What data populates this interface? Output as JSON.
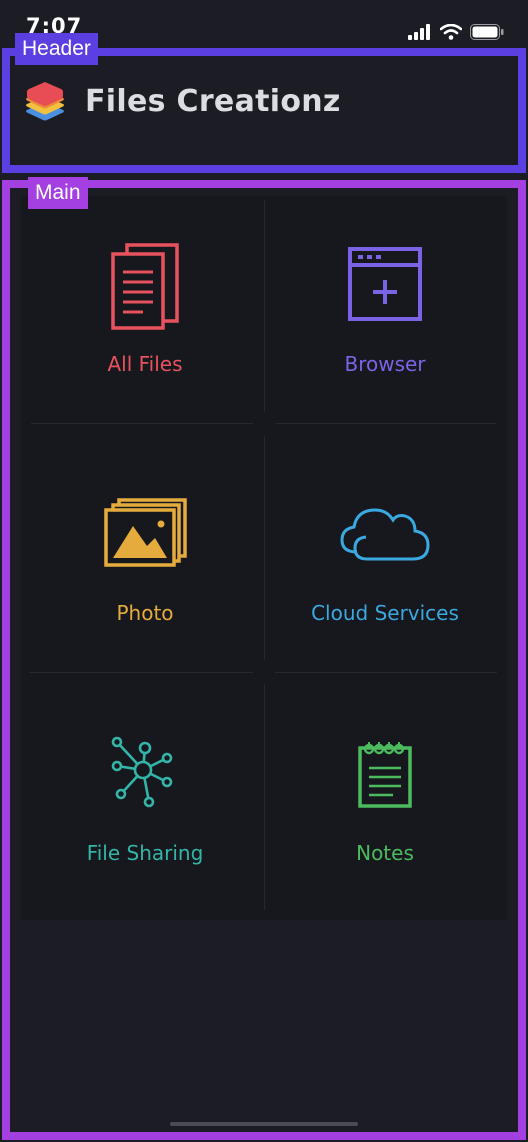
{
  "status_bar": {
    "time": "7:07",
    "icons": [
      "signal-icon",
      "wifi-icon",
      "battery-icon"
    ]
  },
  "regions": {
    "header_label": "Header",
    "main_label": "Main",
    "header_color": "#5b3fe0",
    "main_color": "#a43fe2"
  },
  "header": {
    "app_title": "Files Creationz",
    "logo_icon": "stacked-layers-logo-icon"
  },
  "tiles": [
    {
      "label": "All Files",
      "icon": "documents-icon",
      "color": "#e8525e"
    },
    {
      "label": "Browser",
      "icon": "browser-window-icon",
      "color": "#7b63e6"
    },
    {
      "label": "Photo",
      "icon": "photo-gallery-icon",
      "color": "#e5ac3d"
    },
    {
      "label": "Cloud Services",
      "icon": "cloud-icon",
      "color": "#3aa9e0"
    },
    {
      "label": "File Sharing",
      "icon": "network-share-icon",
      "color": "#33b6a8"
    },
    {
      "label": "Notes",
      "icon": "notepad-icon",
      "color": "#4cbb5e"
    }
  ],
  "colors": {
    "background": "#1c1d24",
    "panel": "#17181e",
    "title": "#dcdde3"
  }
}
